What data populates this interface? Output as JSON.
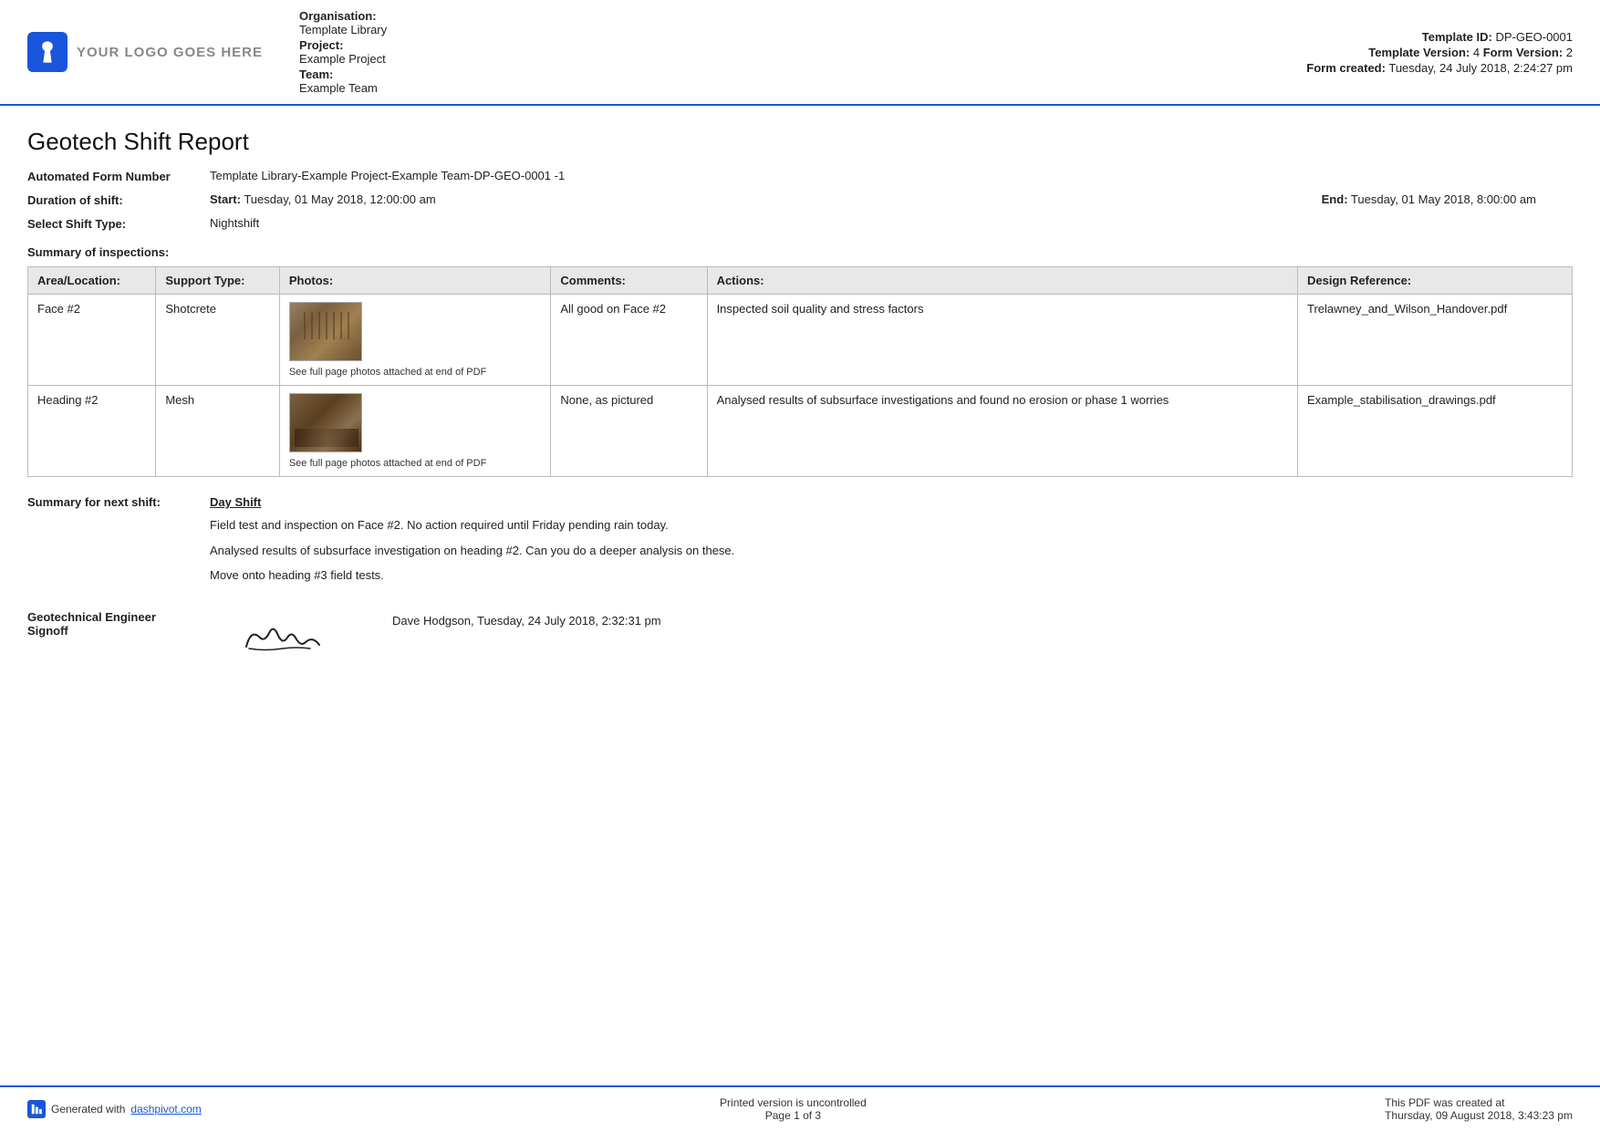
{
  "header": {
    "logo_text": "YOUR LOGO GOES HERE",
    "org_label": "Organisation:",
    "org_value": "Template Library",
    "project_label": "Project:",
    "project_value": "Example Project",
    "team_label": "Team:",
    "team_value": "Example Team",
    "template_id_label": "Template ID:",
    "template_id_value": "DP-GEO-0001",
    "template_version_label": "Template Version:",
    "template_version_value": "4",
    "form_version_label": "Form Version:",
    "form_version_value": "2",
    "form_created_label": "Form created:",
    "form_created_value": "Tuesday, 24 July 2018, 2:24:27 pm"
  },
  "report": {
    "title": "Geotech Shift Report",
    "form_number_label": "Automated Form Number",
    "form_number_value": "Template Library-Example Project-Example Team-DP-GEO-0001   -1",
    "duration_label": "Duration of shift:",
    "duration_start_label": "Start:",
    "duration_start_value": "Tuesday, 01 May 2018, 12:00:00 am",
    "duration_end_label": "End:",
    "duration_end_value": "Tuesday, 01 May 2018, 8:00:00 am",
    "shift_type_label": "Select Shift Type:",
    "shift_type_value": "Nightshift",
    "summary_label": "Summary of inspections:"
  },
  "table": {
    "headers": {
      "area": "Area/Location:",
      "support": "Support Type:",
      "photos": "Photos:",
      "comments": "Comments:",
      "actions": "Actions:",
      "design": "Design Reference:"
    },
    "rows": [
      {
        "area": "Face #2",
        "support": "Shotcrete",
        "photo_caption": "See full page photos attached at end of PDF",
        "comments": "All good on Face #2",
        "actions": "Inspected soil quality and stress factors",
        "design": "Trelawney_and_Wilson_Handover.pdf"
      },
      {
        "area": "Heading #2",
        "support": "Mesh",
        "photo_caption": "See full page photos attached at end of PDF",
        "comments": "None, as pictured",
        "actions": "Analysed results of subsurface investigations and found no erosion or phase 1 worries",
        "design": "Example_stabilisation_drawings.pdf"
      }
    ]
  },
  "next_shift": {
    "label": "Summary for next shift:",
    "header": "Day Shift",
    "paragraphs": [
      "Field test and inspection on Face #2. No action required until Friday pending rain today.",
      "Analysed results of subsurface investigation on heading #2. Can you do a deeper analysis on these.",
      "Move onto heading #3 field tests."
    ]
  },
  "signoff": {
    "label_line1": "Geotechnical Engineer",
    "label_line2": "Signoff",
    "name_date": "Dave Hodgson, Tuesday, 24 July 2018, 2:32:31 pm"
  },
  "footer": {
    "generated_text": "Generated with",
    "link_text": "dashpivot.com",
    "center_text": "Printed version is uncontrolled",
    "page_text": "Page 1 of 3",
    "right_line1": "This PDF was created at",
    "right_line2": "Thursday, 09 August 2018, 3:43:23 pm"
  }
}
